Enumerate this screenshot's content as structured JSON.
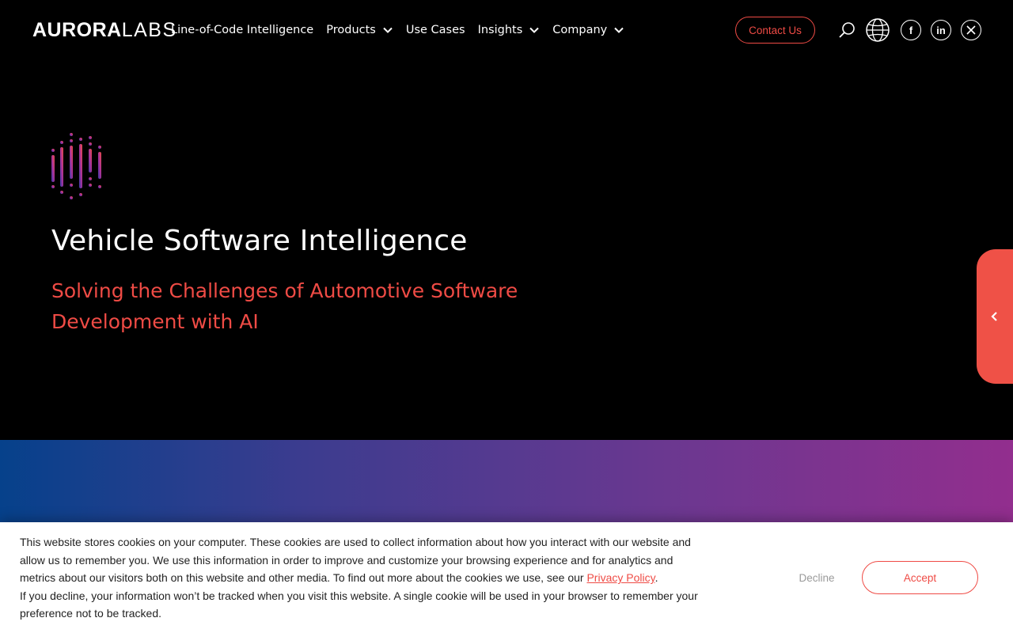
{
  "header": {
    "logo_bold": "AURORA",
    "logo_light": "LABS",
    "nav": [
      {
        "label": "Line-of-Code Intelligence",
        "has_dropdown": false
      },
      {
        "label": "Products",
        "has_dropdown": true
      },
      {
        "label": "Use Cases",
        "has_dropdown": false
      },
      {
        "label": "Insights",
        "has_dropdown": true
      },
      {
        "label": "Company",
        "has_dropdown": true
      }
    ],
    "contact_label": "Contact Us",
    "icons": [
      "search-icon",
      "globe-icon",
      "facebook-icon",
      "linkedin-icon",
      "x-icon"
    ],
    "social": {
      "facebook": "f",
      "linkedin": "in"
    }
  },
  "hero": {
    "title": "Vehicle Software Intelligence",
    "subtitle": "Solving the Challenges of Automotive Software Development with AI"
  },
  "cookie": {
    "text_before_link": "This website stores cookies on your computer. These cookies are used to collect information about how you interact with our website and allow us to remember you. We use this information in order to improve and customize your browsing experience and for analytics and metrics about our visitors both on this website and other media. To find out more about the cookies we use, see our ",
    "link_text": "Privacy Policy",
    "text_after_link": ".",
    "second_paragraph": "If you decline, your information won’t be tracked when you visit this website. A single cookie will be used in your browser to remember your preference not to be tracked.",
    "decline_label": "Decline",
    "accept_label": "Accept"
  },
  "colors": {
    "accent": "#ef4b45",
    "band_start": "#06418b",
    "band_end": "#922e8e"
  }
}
